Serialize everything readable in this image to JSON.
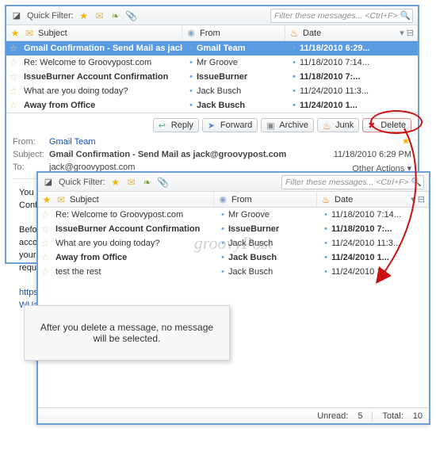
{
  "toolbar": {
    "quick_filter_label": "Quick Filter:",
    "filter_placeholder": "Filter these messages... <Ctrl+F>"
  },
  "columns": {
    "subject": "Subject",
    "from": "From",
    "date": "Date"
  },
  "top_rows": [
    {
      "subject": "Gmail Confirmation - Send Mail as jack@...",
      "from": "Gmail Team",
      "date": "11/18/2010 6:29...",
      "bold": true,
      "selected": true
    },
    {
      "subject": "Re: Welcome to Groovypost.com",
      "from": "Mr Groove",
      "date": "11/18/2010 7:14...",
      "bold": false,
      "selected": false
    },
    {
      "subject": "IssueBurner Account Confirmation",
      "from": "IssueBurner",
      "date": "11/18/2010 7:...",
      "bold": true,
      "selected": false
    },
    {
      "subject": "What are you doing today?",
      "from": "Jack Busch",
      "date": "11/24/2010 11:3...",
      "bold": false,
      "selected": false
    },
    {
      "subject": "Away from Office",
      "from": "Jack Busch",
      "date": "11/24/2010 1...",
      "bold": true,
      "selected": false
    }
  ],
  "bot_rows": [
    {
      "subject": "Re: Welcome to Groovypost.com",
      "from": "Mr Groove",
      "date": "11/18/2010 7:14...",
      "bold": false
    },
    {
      "subject": "IssueBurner Account Confirmation",
      "from": "IssueBurner",
      "date": "11/18/2010 7:...",
      "bold": true
    },
    {
      "subject": "What are you doing today?",
      "from": "Jack Busch",
      "date": "11/24/2010 11:3...",
      "bold": false
    },
    {
      "subject": "Away from Office",
      "from": "Jack Busch",
      "date": "11/24/2010 1...",
      "bold": true
    },
    {
      "subject": "test the rest",
      "from": "Jack Busch",
      "date": "11/24/2010 1...",
      "bold": false
    }
  ],
  "buttons": {
    "reply": "Reply",
    "forward": "Forward",
    "archive": "Archive",
    "junk": "Junk",
    "delete": "Delete"
  },
  "preview": {
    "from_label": "From:",
    "from_value": "Gmail Team",
    "subject_label": "Subject:",
    "subject_value": "Gmail Confirmation - Send Mail as jack@groovypost.com",
    "to_label": "To:",
    "to_value": "jack@groovypost.com",
    "date": "11/18/2010 6:29 PM",
    "other_actions": "Other Actions ▾",
    "body_line1": "You have requested to add jack@groovypost.com to your Gmail account.",
    "body_line2": "Confirm",
    "body_line3": "Before",
    "body_line4": "account",
    "body_line5": "your",
    "body_line6": "request",
    "body_link1": "https:/",
    "body_link2": "WUag-TG"
  },
  "status": {
    "unread_label": "Unread:",
    "unread_value": "5",
    "total_label": "Total:",
    "total_value": "10"
  },
  "callout": "After you delete a message, no message will be selected.",
  "watermark": "groovyPost"
}
